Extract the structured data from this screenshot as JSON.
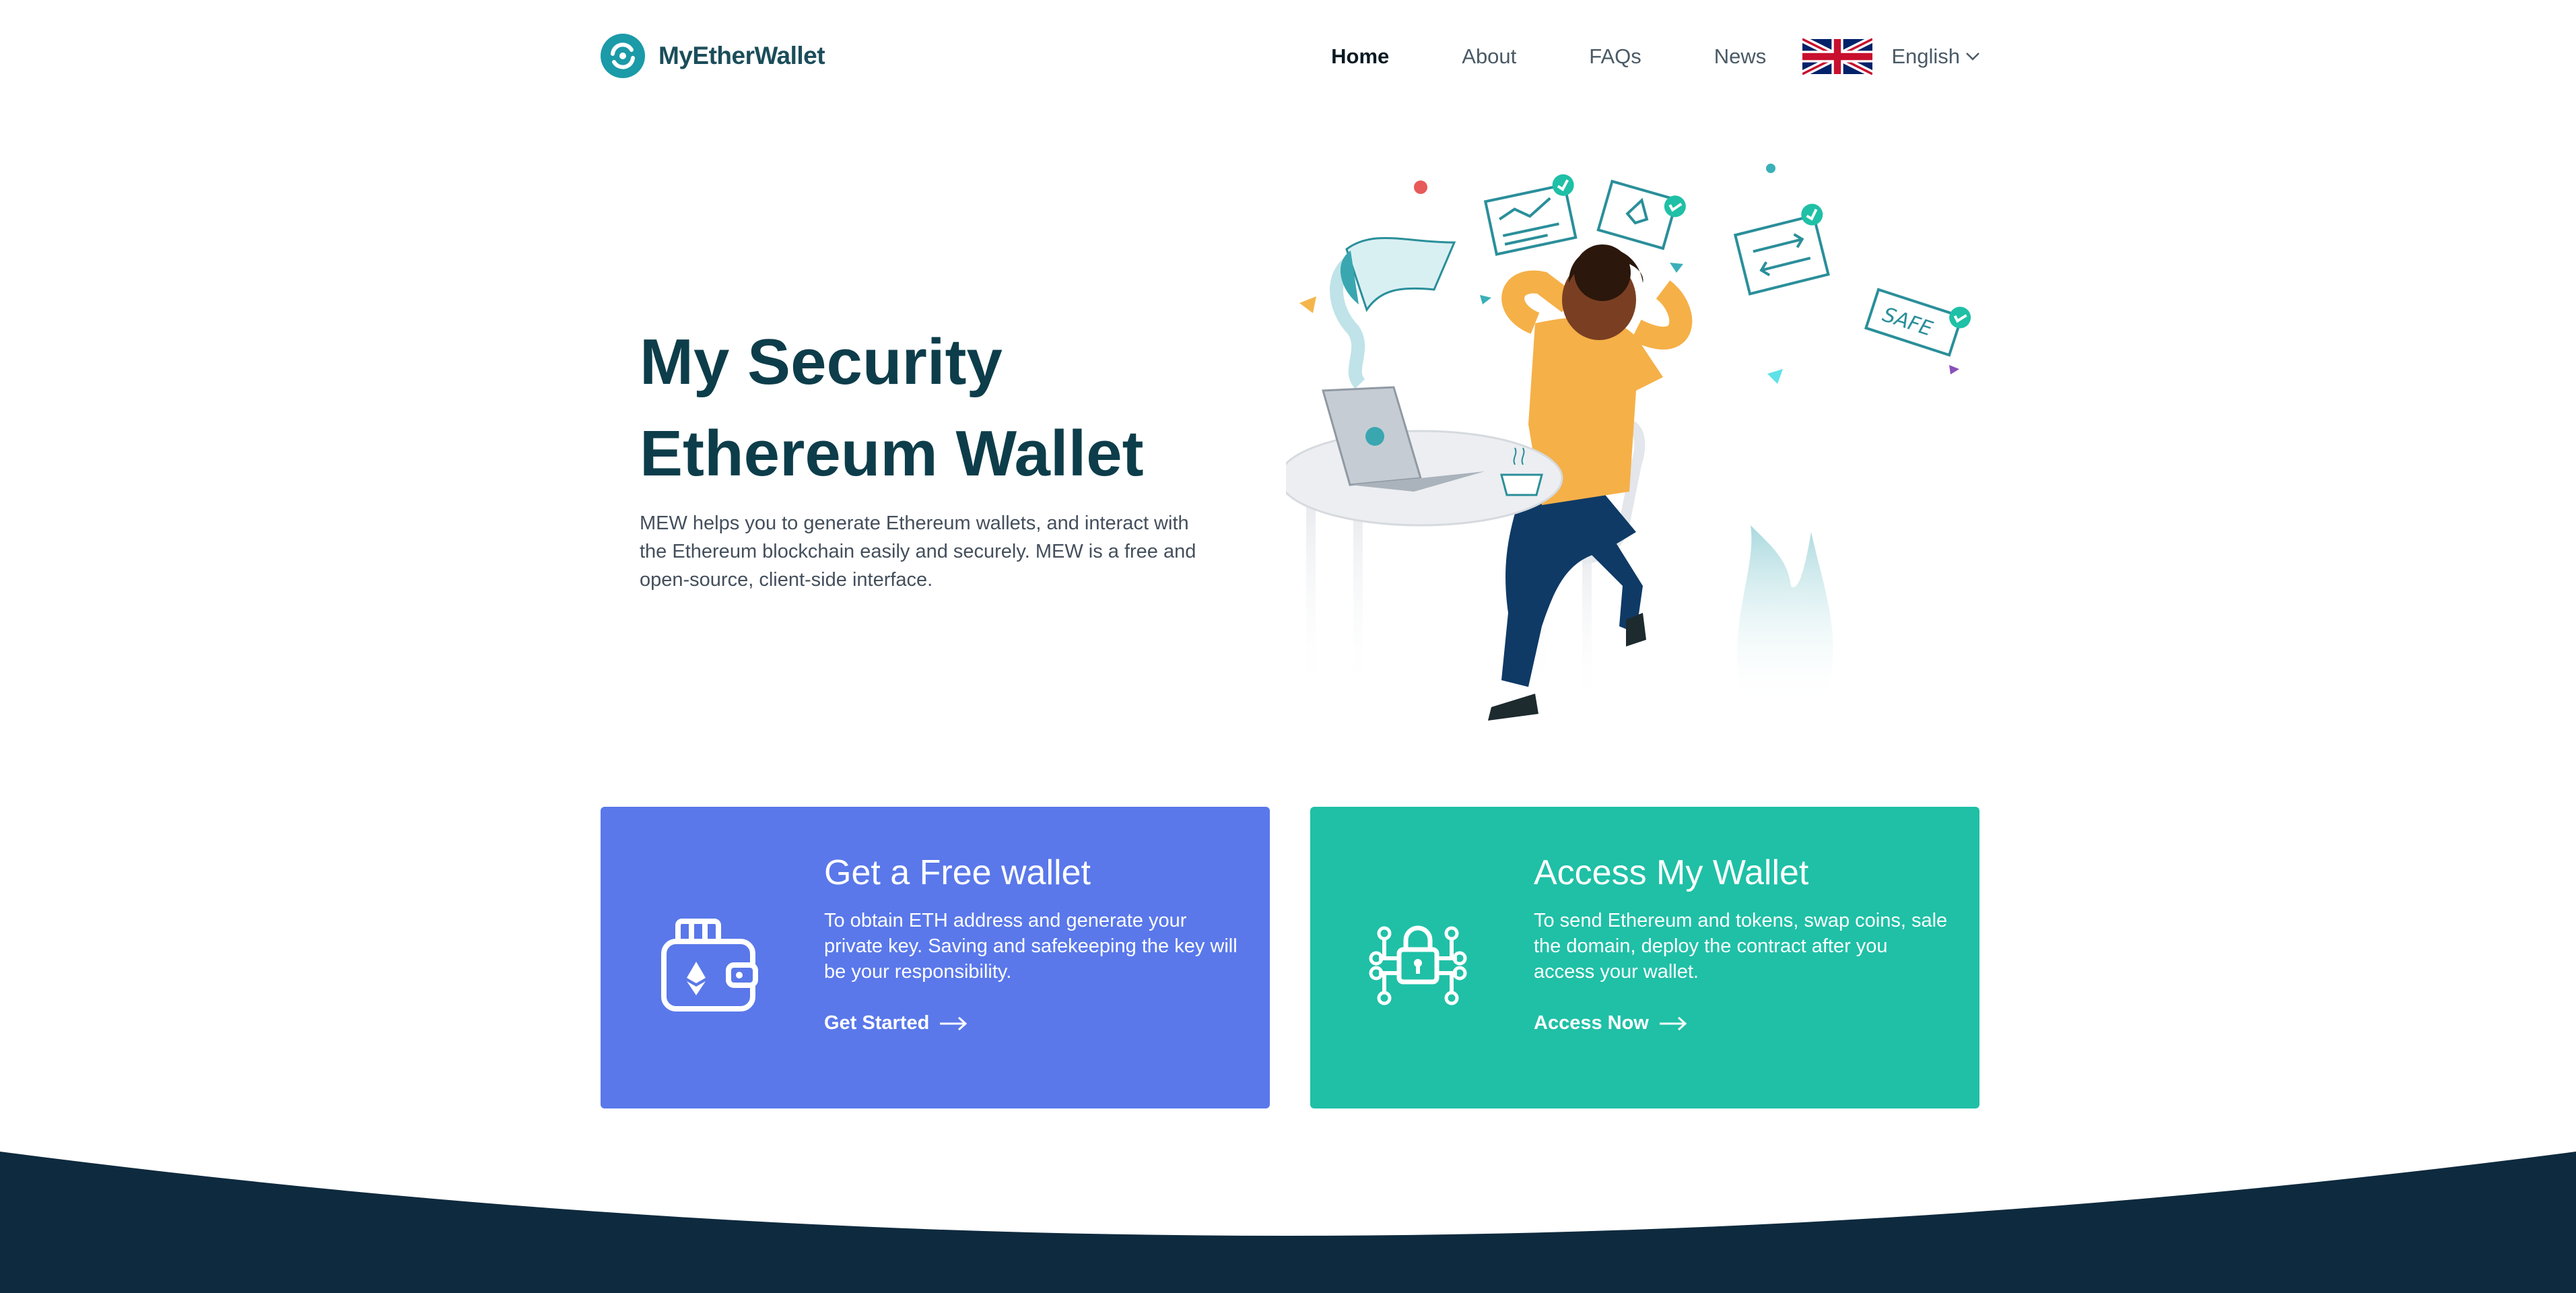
{
  "header": {
    "logo_text": "MyEtherWallet",
    "nav": [
      {
        "label": "Home",
        "active": true
      },
      {
        "label": "About"
      },
      {
        "label": "FAQs"
      },
      {
        "label": "News"
      }
    ],
    "language": "English",
    "flag_icon": "uk-flag-icon"
  },
  "hero": {
    "title_line1": "My Security",
    "title_line2": "Ethereum Wallet",
    "description": "MEW helps you to generate Ethereum wallets, and interact with the Ethereum blockchain easily and securely. MEW is a free and open-source, client-side interface."
  },
  "cards": {
    "create": {
      "title": "Get a Free wallet",
      "description": "To obtain ETH address and generate your private key. Saving and safekeeping the key will be your responsibility.",
      "link": "Get Started",
      "icon": "wallet-icon",
      "color": "#5a78ea"
    },
    "access": {
      "title": "Access My Wallet",
      "description": "To send Ethereum and tokens, swap coins, sale the domain, deploy the contract after you access your wallet.",
      "link": "Access Now",
      "icon": "lock-circuit-icon",
      "color": "#1fc0a6"
    }
  },
  "illustration": {
    "safe_note": "SAFE"
  },
  "colors": {
    "footer": "#0e2a3e",
    "brand": "#1b9aa8"
  }
}
